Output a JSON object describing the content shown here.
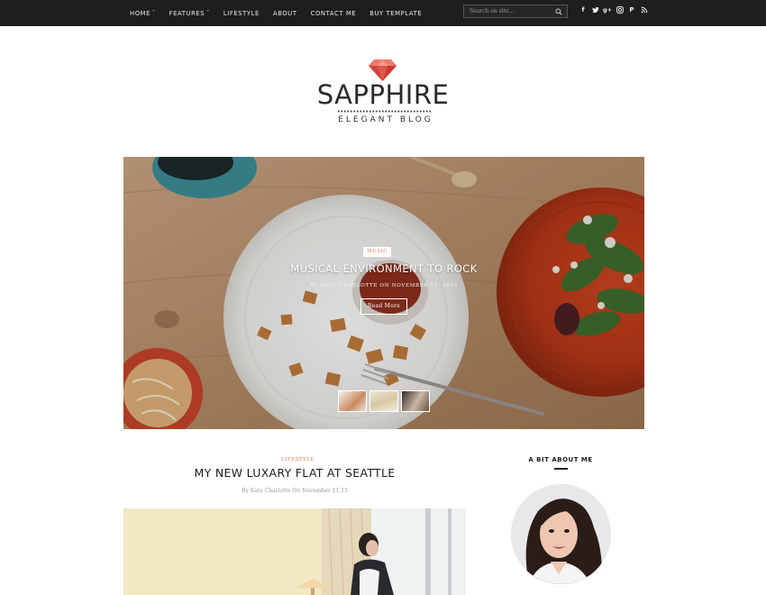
{
  "nav": {
    "items": [
      {
        "label": "HOME",
        "caret": "˅"
      },
      {
        "label": "FEATURES",
        "caret": "˅"
      },
      {
        "label": "LIFESTYLE",
        "caret": ""
      },
      {
        "label": "ABOUT",
        "caret": ""
      },
      {
        "label": "CONTACT ME",
        "caret": ""
      },
      {
        "label": "BUY TEMPLATE",
        "caret": ""
      }
    ],
    "search_placeholder": "Search on site...",
    "social": [
      {
        "name": "facebook-icon",
        "glyph": "f"
      },
      {
        "name": "twitter-icon",
        "glyph": ""
      },
      {
        "name": "google-plus-icon",
        "glyph": "g+"
      },
      {
        "name": "instagram-icon",
        "glyph": ""
      },
      {
        "name": "pinterest-icon",
        "glyph": "P"
      },
      {
        "name": "rss-icon",
        "glyph": ""
      }
    ]
  },
  "logo": {
    "title": "SAPPHIRE",
    "tagline": "ELEGANT BLOG",
    "gem_color": "#e2574c"
  },
  "hero": {
    "category": "MUSIC",
    "title": "MUSICAL ENVIRONMENT TO ROCK",
    "meta": "BY KATE CHARLOTTE ON NOVEMBER 11, 2015",
    "button": "Read More"
  },
  "post": {
    "category": "LIFESTYLE",
    "title": "MY NEW LUXARY FLAT AT SEATTLE",
    "meta": "By Kate Charlotte On November 11,15"
  },
  "sidebar": {
    "widget_title": "A BIT ABOUT ME"
  },
  "colors": {
    "topbar": "#1e1e1e",
    "accent": "#e0785e"
  }
}
